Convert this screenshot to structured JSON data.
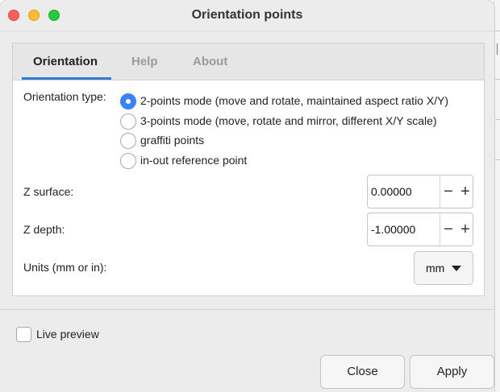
{
  "window": {
    "title": "Orientation points"
  },
  "tabs": [
    {
      "label": "Orientation",
      "active": true
    },
    {
      "label": "Help",
      "active": false
    },
    {
      "label": "About",
      "active": false
    }
  ],
  "orientation": {
    "type_label": "Orientation type:",
    "options": [
      {
        "label": "2-points mode (move and rotate, maintained aspect ratio X/Y)",
        "selected": true
      },
      {
        "label": "3-points mode (move, rotate and mirror, different X/Y scale)",
        "selected": false
      },
      {
        "label": "graffiti points",
        "selected": false
      },
      {
        "label": "in-out reference point",
        "selected": false
      }
    ],
    "z_surface": {
      "label": "Z surface:",
      "value": "0.00000"
    },
    "z_depth": {
      "label": "Z depth:",
      "value": "-1.00000"
    },
    "units": {
      "label": "Units (mm or in):",
      "value": "mm"
    }
  },
  "footer": {
    "live_preview_label": "Live preview",
    "live_preview_checked": false,
    "close_label": "Close",
    "apply_label": "Apply"
  },
  "icons": {
    "minus": "−",
    "plus": "+"
  },
  "colors": {
    "accent": "#3b82f6",
    "tab_underline": "#2e7ad6",
    "close_light": "#fe5f57",
    "minimize_light": "#febc2e",
    "zoom_light": "#28c840"
  }
}
